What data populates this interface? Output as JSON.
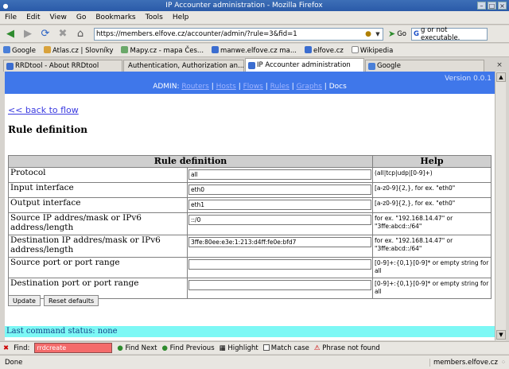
{
  "window": {
    "title": "IP Accounter administration - Mozilla Firefox"
  },
  "menu": {
    "items": [
      "File",
      "Edit",
      "View",
      "Go",
      "Bookmarks",
      "Tools",
      "Help"
    ]
  },
  "nav": {
    "url": "https://members.elfove.cz/accounter/admin/?rule=3&fid=1",
    "go_label": "Go",
    "search_value": "g or not executable."
  },
  "bookmarks": {
    "items": [
      "Google",
      "Atlas.cz | Slovníky",
      "Mapy.cz - mapa Čes...",
      "manwe.elfove.cz ma...",
      "elfove.cz",
      "Wikipedia"
    ]
  },
  "tabs": {
    "items": [
      "RRDtool - About RRDtool",
      "Authentication, Authorization an...",
      "IP Accounter administration",
      "Google"
    ]
  },
  "page": {
    "version": "Version 0.0.1",
    "admin_label": "ADMIN:",
    "admin_links": [
      "Routers",
      "Hosts",
      "Flows",
      "Rules",
      "Graphs"
    ],
    "admin_current": "Docs",
    "back_link": "<< back to flow",
    "heading": "Rule definition",
    "table": {
      "col_rule": "Rule definition",
      "col_help": "Help",
      "rows": [
        {
          "label": "Protocol",
          "value": "all",
          "help": "(all|tcp|udp|[0-9]+)"
        },
        {
          "label": "Input interface",
          "value": "eth0",
          "help": "[a-z0-9]{2,}, for ex. \"eth0\""
        },
        {
          "label": "Output interface",
          "value": "eth1",
          "help": "[a-z0-9]{2,}, for ex. \"eth0\""
        },
        {
          "label": "Source IP addres/mask or IPv6 address/length",
          "value": "::/0",
          "help": "for ex. \"192.168.14.47\" or \"3ffe:abcd::/64\""
        },
        {
          "label": "Destination IP addres/mask or IPv6 address/length",
          "value": "3ffe:80ee:e3e:1:213:d4ff:fe0e:bfd7",
          "help": "for ex. \"192.168.14.47\" or \"3ffe:abcd::/64\""
        },
        {
          "label": "Source port or port range",
          "value": "",
          "help": "[0-9]+:{0,1}[0-9]* or empty string for all"
        },
        {
          "label": "Destination port or port range",
          "value": "",
          "help": "[0-9]+:{0,1}[0-9]* or empty string for all"
        }
      ]
    },
    "update_button": "Update",
    "reset_button": "Reset defaults",
    "status": "Last command status: none"
  },
  "findbar": {
    "label": "Find:",
    "value": "rrdcreate",
    "find_next": "Find Next",
    "find_previous": "Find Previous",
    "highlight": "Highlight",
    "match_case": "Match case",
    "message": "Phrase not found"
  },
  "statusbar": {
    "left": "Done",
    "right": "members.elfove.cz"
  },
  "colors": {
    "admin_bar": "#3f77ea",
    "status_bar": "#7df8f5",
    "find_error": "#f46b6b"
  }
}
